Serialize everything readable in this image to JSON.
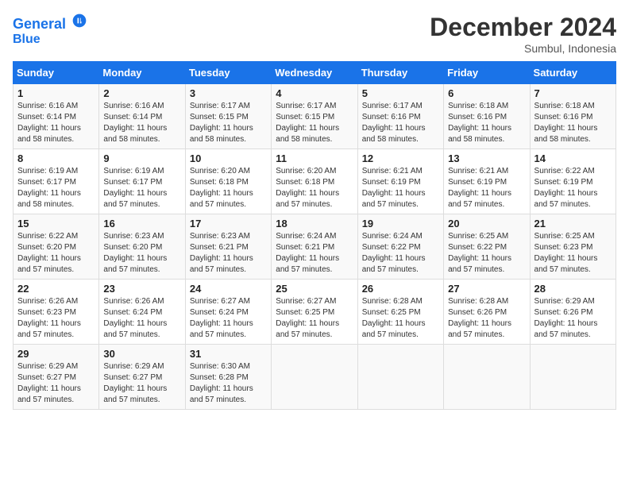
{
  "logo": {
    "line1": "General",
    "line2": "Blue"
  },
  "title": "December 2024",
  "subtitle": "Sumbul, Indonesia",
  "days_of_week": [
    "Sunday",
    "Monday",
    "Tuesday",
    "Wednesday",
    "Thursday",
    "Friday",
    "Saturday"
  ],
  "weeks": [
    [
      {
        "day": "1",
        "info": "Sunrise: 6:16 AM\nSunset: 6:14 PM\nDaylight: 11 hours\nand 58 minutes."
      },
      {
        "day": "2",
        "info": "Sunrise: 6:16 AM\nSunset: 6:14 PM\nDaylight: 11 hours\nand 58 minutes."
      },
      {
        "day": "3",
        "info": "Sunrise: 6:17 AM\nSunset: 6:15 PM\nDaylight: 11 hours\nand 58 minutes."
      },
      {
        "day": "4",
        "info": "Sunrise: 6:17 AM\nSunset: 6:15 PM\nDaylight: 11 hours\nand 58 minutes."
      },
      {
        "day": "5",
        "info": "Sunrise: 6:17 AM\nSunset: 6:16 PM\nDaylight: 11 hours\nand 58 minutes."
      },
      {
        "day": "6",
        "info": "Sunrise: 6:18 AM\nSunset: 6:16 PM\nDaylight: 11 hours\nand 58 minutes."
      },
      {
        "day": "7",
        "info": "Sunrise: 6:18 AM\nSunset: 6:16 PM\nDaylight: 11 hours\nand 58 minutes."
      }
    ],
    [
      {
        "day": "8",
        "info": "Sunrise: 6:19 AM\nSunset: 6:17 PM\nDaylight: 11 hours\nand 58 minutes."
      },
      {
        "day": "9",
        "info": "Sunrise: 6:19 AM\nSunset: 6:17 PM\nDaylight: 11 hours\nand 57 minutes."
      },
      {
        "day": "10",
        "info": "Sunrise: 6:20 AM\nSunset: 6:18 PM\nDaylight: 11 hours\nand 57 minutes."
      },
      {
        "day": "11",
        "info": "Sunrise: 6:20 AM\nSunset: 6:18 PM\nDaylight: 11 hours\nand 57 minutes."
      },
      {
        "day": "12",
        "info": "Sunrise: 6:21 AM\nSunset: 6:19 PM\nDaylight: 11 hours\nand 57 minutes."
      },
      {
        "day": "13",
        "info": "Sunrise: 6:21 AM\nSunset: 6:19 PM\nDaylight: 11 hours\nand 57 minutes."
      },
      {
        "day": "14",
        "info": "Sunrise: 6:22 AM\nSunset: 6:19 PM\nDaylight: 11 hours\nand 57 minutes."
      }
    ],
    [
      {
        "day": "15",
        "info": "Sunrise: 6:22 AM\nSunset: 6:20 PM\nDaylight: 11 hours\nand 57 minutes."
      },
      {
        "day": "16",
        "info": "Sunrise: 6:23 AM\nSunset: 6:20 PM\nDaylight: 11 hours\nand 57 minutes."
      },
      {
        "day": "17",
        "info": "Sunrise: 6:23 AM\nSunset: 6:21 PM\nDaylight: 11 hours\nand 57 minutes."
      },
      {
        "day": "18",
        "info": "Sunrise: 6:24 AM\nSunset: 6:21 PM\nDaylight: 11 hours\nand 57 minutes."
      },
      {
        "day": "19",
        "info": "Sunrise: 6:24 AM\nSunset: 6:22 PM\nDaylight: 11 hours\nand 57 minutes."
      },
      {
        "day": "20",
        "info": "Sunrise: 6:25 AM\nSunset: 6:22 PM\nDaylight: 11 hours\nand 57 minutes."
      },
      {
        "day": "21",
        "info": "Sunrise: 6:25 AM\nSunset: 6:23 PM\nDaylight: 11 hours\nand 57 minutes."
      }
    ],
    [
      {
        "day": "22",
        "info": "Sunrise: 6:26 AM\nSunset: 6:23 PM\nDaylight: 11 hours\nand 57 minutes."
      },
      {
        "day": "23",
        "info": "Sunrise: 6:26 AM\nSunset: 6:24 PM\nDaylight: 11 hours\nand 57 minutes."
      },
      {
        "day": "24",
        "info": "Sunrise: 6:27 AM\nSunset: 6:24 PM\nDaylight: 11 hours\nand 57 minutes."
      },
      {
        "day": "25",
        "info": "Sunrise: 6:27 AM\nSunset: 6:25 PM\nDaylight: 11 hours\nand 57 minutes."
      },
      {
        "day": "26",
        "info": "Sunrise: 6:28 AM\nSunset: 6:25 PM\nDaylight: 11 hours\nand 57 minutes."
      },
      {
        "day": "27",
        "info": "Sunrise: 6:28 AM\nSunset: 6:26 PM\nDaylight: 11 hours\nand 57 minutes."
      },
      {
        "day": "28",
        "info": "Sunrise: 6:29 AM\nSunset: 6:26 PM\nDaylight: 11 hours\nand 57 minutes."
      }
    ],
    [
      {
        "day": "29",
        "info": "Sunrise: 6:29 AM\nSunset: 6:27 PM\nDaylight: 11 hours\nand 57 minutes."
      },
      {
        "day": "30",
        "info": "Sunrise: 6:29 AM\nSunset: 6:27 PM\nDaylight: 11 hours\nand 57 minutes."
      },
      {
        "day": "31",
        "info": "Sunrise: 6:30 AM\nSunset: 6:28 PM\nDaylight: 11 hours\nand 57 minutes."
      },
      {
        "day": "",
        "info": ""
      },
      {
        "day": "",
        "info": ""
      },
      {
        "day": "",
        "info": ""
      },
      {
        "day": "",
        "info": ""
      }
    ]
  ]
}
